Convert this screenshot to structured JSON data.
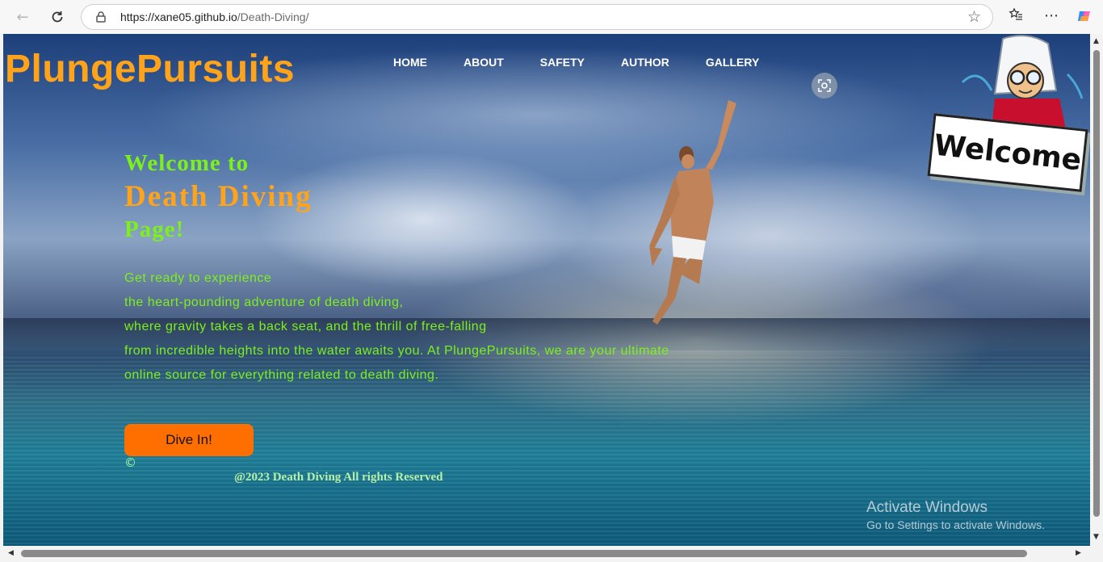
{
  "browser": {
    "url_host": "https://xane05.github.io",
    "url_path": "/Death-Diving/",
    "icons": {
      "back": "back-arrow-icon",
      "reload": "reload-icon",
      "lock": "lock-icon",
      "star": "star-icon",
      "favorites": "favorites-icon",
      "menu": "more-icon",
      "copilot": "copilot-icon"
    }
  },
  "site": {
    "brand": "PlungePursuits",
    "nav": [
      "HOME",
      "ABOUT",
      "SAFETY",
      "AUTHOR",
      "GALLERY"
    ]
  },
  "hero": {
    "line1": "Welcome to",
    "line2": "Death Diving",
    "line3": "Page!",
    "intro": [
      "Get ready to experience",
      "the heart-pounding adventure of death diving,",
      "where gravity takes a back seat, and the thrill of free-falling",
      "from incredible heights into the water awaits you. At PlungePursuits, we are your ultimate",
      "online source for everything related to death diving."
    ],
    "cta": "Dive In!"
  },
  "footer": {
    "symbol": "©",
    "text": "@2023 Death Diving All rights Reserved"
  },
  "sign": {
    "text": "Welcome"
  },
  "watermark": {
    "title": "Activate Windows",
    "subtitle": "Go to Settings to activate Windows."
  },
  "colors": {
    "brand": "#ffa31a",
    "green": "#7cf01a",
    "cta": "#ff6f00"
  }
}
